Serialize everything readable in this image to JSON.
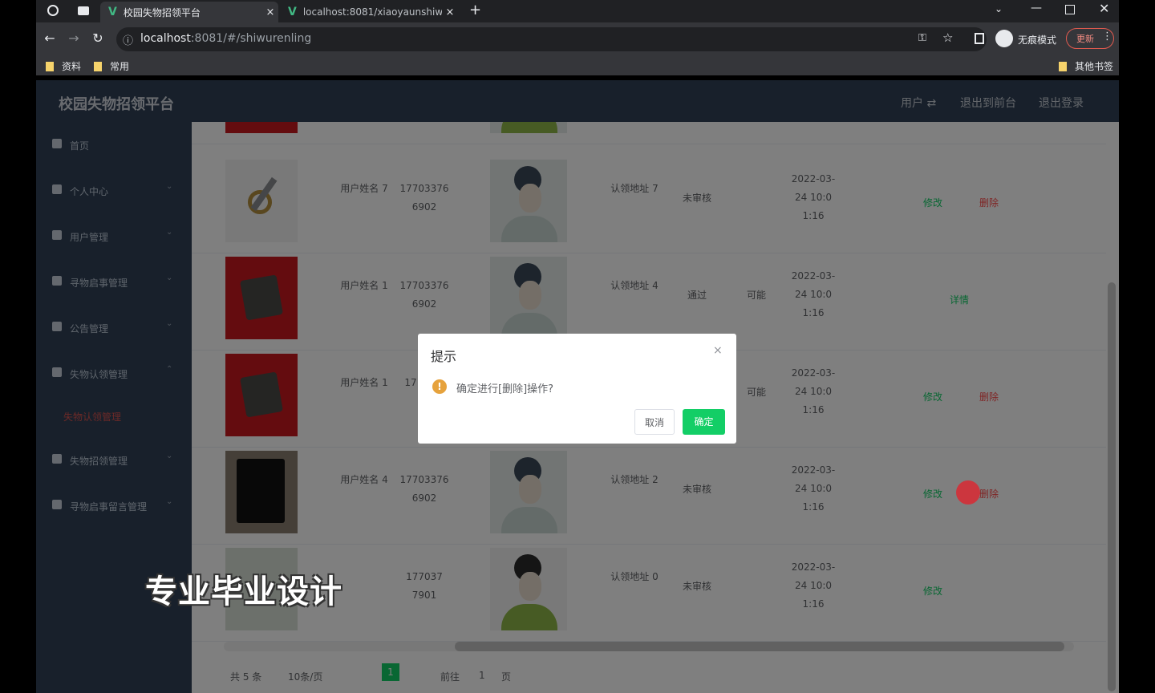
{
  "browser": {
    "tabs": [
      {
        "title": "校园失物招领平台",
        "active": true
      },
      {
        "title": "localhost:8081/xiaoyaunshiw",
        "active": false
      }
    ],
    "url_host": "localhost",
    "url_path": ":8081/#/shiwurenling",
    "profile_label": "无痕模式",
    "update_label": "更新",
    "bookmarks": [
      "资料",
      "常用"
    ],
    "other_bookmarks": "其他书签"
  },
  "app": {
    "title": "校园失物招领平台",
    "header_links": [
      "用户 ⇄",
      "退出到前台",
      "退出登录"
    ],
    "sidebar": [
      {
        "label": "首页"
      },
      {
        "label": "个人中心"
      },
      {
        "label": "用户管理"
      },
      {
        "label": "寻物启事管理"
      },
      {
        "label": "公告管理"
      },
      {
        "label": "失物认领管理"
      },
      {
        "label": "失物认领管理",
        "sub": true
      },
      {
        "label": "失物招领管理"
      },
      {
        "label": "寻物启事留言管理"
      }
    ],
    "rows": [
      {
        "photo": "keys",
        "user": "用户姓名 7",
        "phone": "17703376 6902",
        "avatar": "grey",
        "col5": "认领地址 7",
        "status": "未审核",
        "reply": "",
        "time": [
          "2022-03-",
          "24 10:0",
          "1:16"
        ],
        "actions": [
          "修改",
          "删除"
        ]
      },
      {
        "photo": "wallet",
        "user": "用户姓名 1",
        "phone": "17703376 6902",
        "avatar": "grey",
        "col5": "认领地址 4",
        "status": "通过",
        "reply": "可能",
        "time": [
          "2022-03-",
          "24 10:0",
          "1:16"
        ],
        "actions": [
          "详情"
        ]
      },
      {
        "photo": "wallet",
        "user": "用户姓名 1",
        "phone": "17",
        "avatar": "grey",
        "col5": "",
        "status": "",
        "reply": "可能",
        "time": [
          "2022-03-",
          "24 10:0",
          "1:16"
        ],
        "actions": [
          "修改",
          "删除"
        ]
      },
      {
        "photo": "phone",
        "user": "用户姓名 4",
        "phone": "17703376 6902",
        "avatar": "grey",
        "col5": "认领地址 2",
        "status": "未审核",
        "reply": "",
        "time": [
          "2022-03-",
          "24 10:0",
          "1:16"
        ],
        "actions": [
          "修改",
          "删除"
        ]
      },
      {
        "photo": "keys",
        "user": "",
        "phone": "177037 7901",
        "avatar": "green",
        "col5": "认领地址 0",
        "status": "未审核",
        "reply": "",
        "time": [
          "2022-03-",
          "24 10:0",
          "1:16"
        ],
        "actions": [
          "修改"
        ]
      }
    ],
    "pagination": {
      "total": "共 5 条",
      "page_size": "10条/页",
      "current": "1",
      "goto": "前往",
      "page_input": "1",
      "page_unit": "页"
    }
  },
  "dialog": {
    "title": "提示",
    "close": "×",
    "icon": "!",
    "message": "确定进行[删除]操作?",
    "cancel": "取消",
    "confirm": "确定"
  },
  "watermark": "专业毕业设计"
}
